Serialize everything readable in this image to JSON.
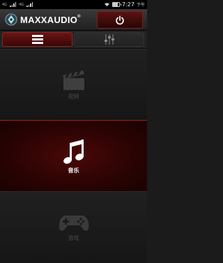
{
  "status_bar": {
    "network_1": "4G",
    "network_2": "4G",
    "time": "7:27",
    "ampm": "下午"
  },
  "header": {
    "brand": "MAXXAUDIO",
    "trademark": "®",
    "power_icon": "power-icon",
    "logo_icon": "maxxaudio-logo-icon"
  },
  "tabs": [
    {
      "name": "list",
      "icon": "list-icon",
      "selected": true
    },
    {
      "name": "equalizer",
      "icon": "sliders-icon",
      "selected": false
    }
  ],
  "modes": [
    {
      "label": "视频",
      "icon": "clapperboard-icon",
      "selected": false
    },
    {
      "label": "音乐",
      "icon": "music-note-icon",
      "selected": true
    },
    {
      "label": "游戏",
      "icon": "gamepad-icon",
      "selected": false
    }
  ],
  "colors": {
    "accent": "#7a1212",
    "background": "#1b1b1b",
    "dim_icon": "#4a4a4a"
  }
}
